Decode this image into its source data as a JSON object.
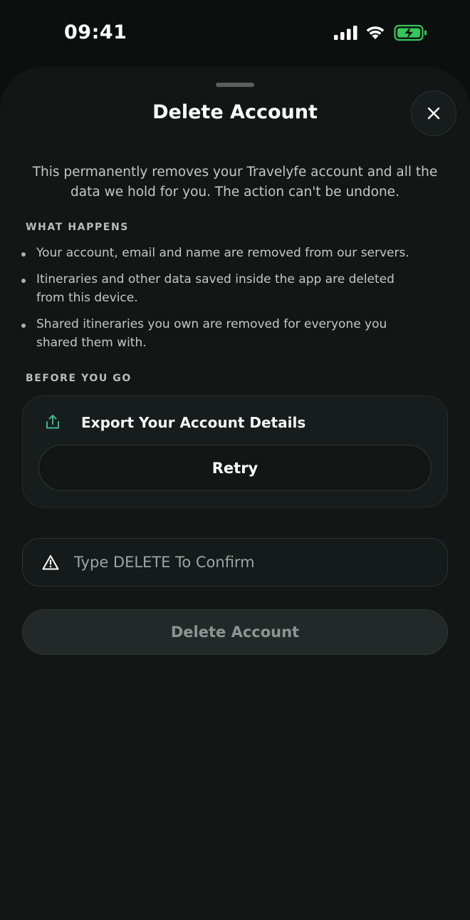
{
  "status_bar": {
    "time": "09:41",
    "icons": [
      "cellular-signal-icon",
      "wifi-icon",
      "battery-charging-icon"
    ],
    "battery_color": "#34c759"
  },
  "sheet": {
    "title": "Delete Account",
    "close_icon": "close-icon",
    "intro": "This permanently removes your Travelyfe account and all the data we hold for you. The action can't be undone.",
    "what_happens": {
      "label": "WHAT HAPPENS",
      "items": [
        "Your account, email and name are removed from our servers.",
        "Itineraries and other data saved inside the app are deleted from this device.",
        "Shared itineraries you own are removed for everyone you shared them with."
      ]
    },
    "before_you_go": {
      "label": "BEFORE YOU GO",
      "export_title": "Export Your Account Details",
      "export_icon": "share-export-icon",
      "retry_label": "Retry"
    },
    "confirm": {
      "icon": "warning-icon",
      "placeholder": "Type DELETE To Confirm",
      "value": ""
    },
    "delete_button_label": "Delete Account"
  },
  "colors": {
    "background": "#0b0f0e",
    "sheet": "#121716",
    "accent_green": "#3fb58a",
    "disabled_text": "#8e9492"
  }
}
